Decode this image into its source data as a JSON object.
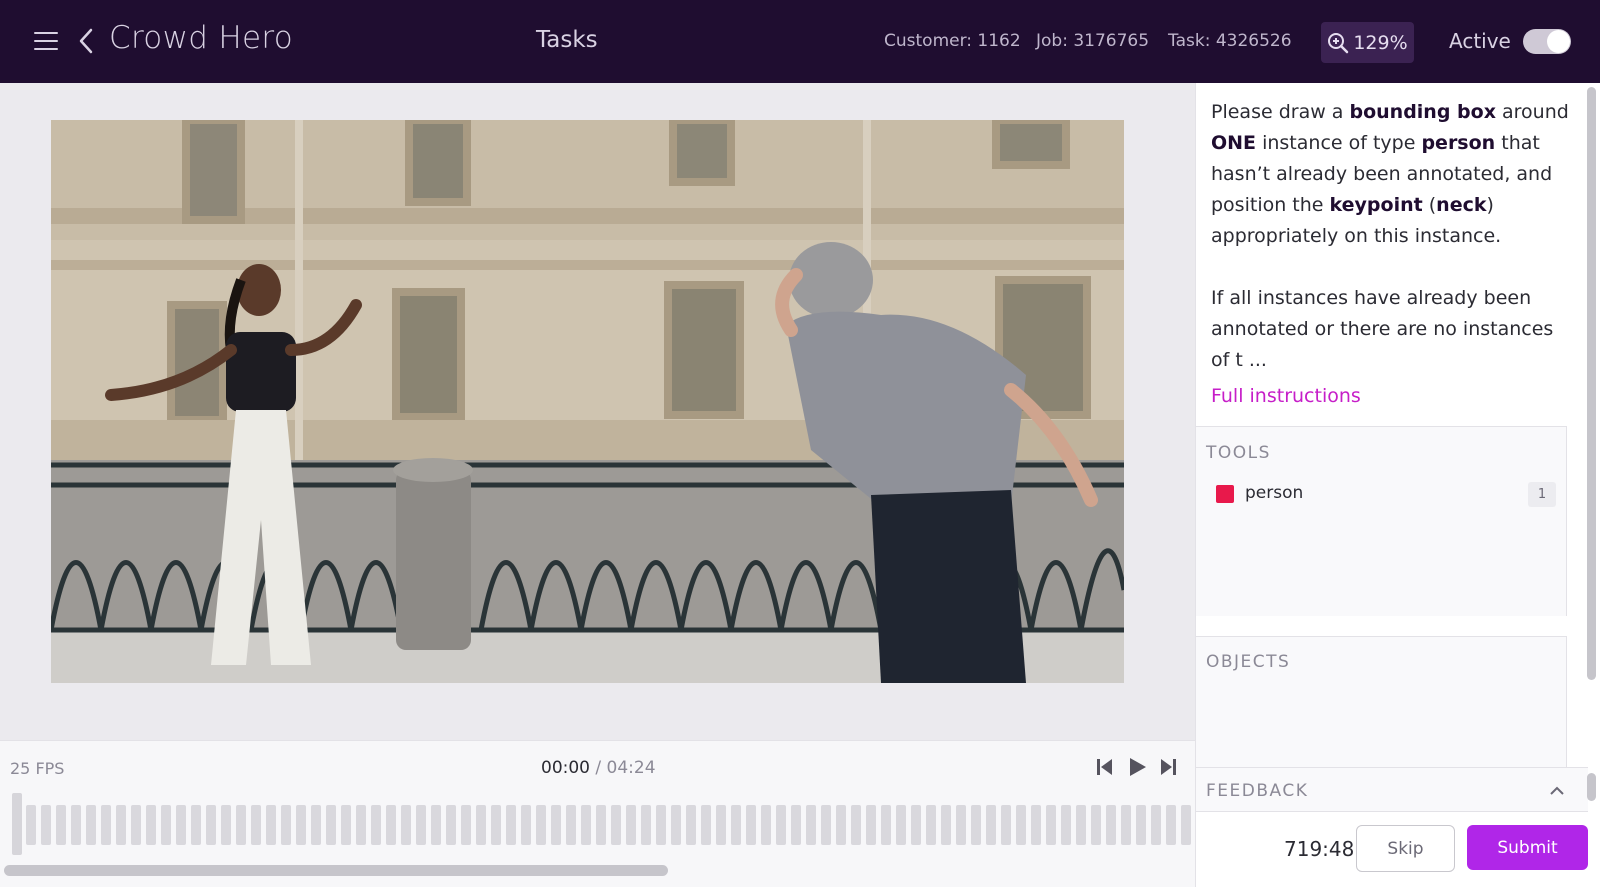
{
  "header": {
    "app_title": "Crowd Hero",
    "page_title": "Tasks",
    "customer": "Customer: 1162",
    "job": "Job: 3176765",
    "task": "Task: 4326526",
    "zoom": "129%",
    "active_label": "Active",
    "active": true
  },
  "timeline": {
    "fps": "25 FPS",
    "current_time": "00:00",
    "separator": "/",
    "total_time": "04:24"
  },
  "instructions": {
    "t1": "Please draw a ",
    "b1": "bounding box",
    "t2": " around ",
    "b2": "ONE",
    "t3": " instance of type ",
    "b3": "person",
    "t4": " that hasn’t already been annotated, and position the ",
    "b4": "keypoint",
    "t5": " (",
    "b5": "neck",
    "t6": ") appropriately on this instance.",
    "p2": "If all instances have already been annotated or there are no instances of t ...",
    "link": "Full instructions"
  },
  "tools": {
    "title": "TOOLS",
    "items": [
      {
        "label": "person",
        "count": "1",
        "color": "#e8194b"
      }
    ]
  },
  "objects": {
    "title": "OBJECTS"
  },
  "feedback": {
    "title": "FEEDBACK"
  },
  "footer": {
    "timer": "719:48",
    "skip_label": "Skip",
    "submit_label": "Submit"
  },
  "colors": {
    "header_bg": "#1f0d30",
    "accent": "#b026e8",
    "link": "#c61ec8",
    "person_tool": "#e8194b"
  }
}
